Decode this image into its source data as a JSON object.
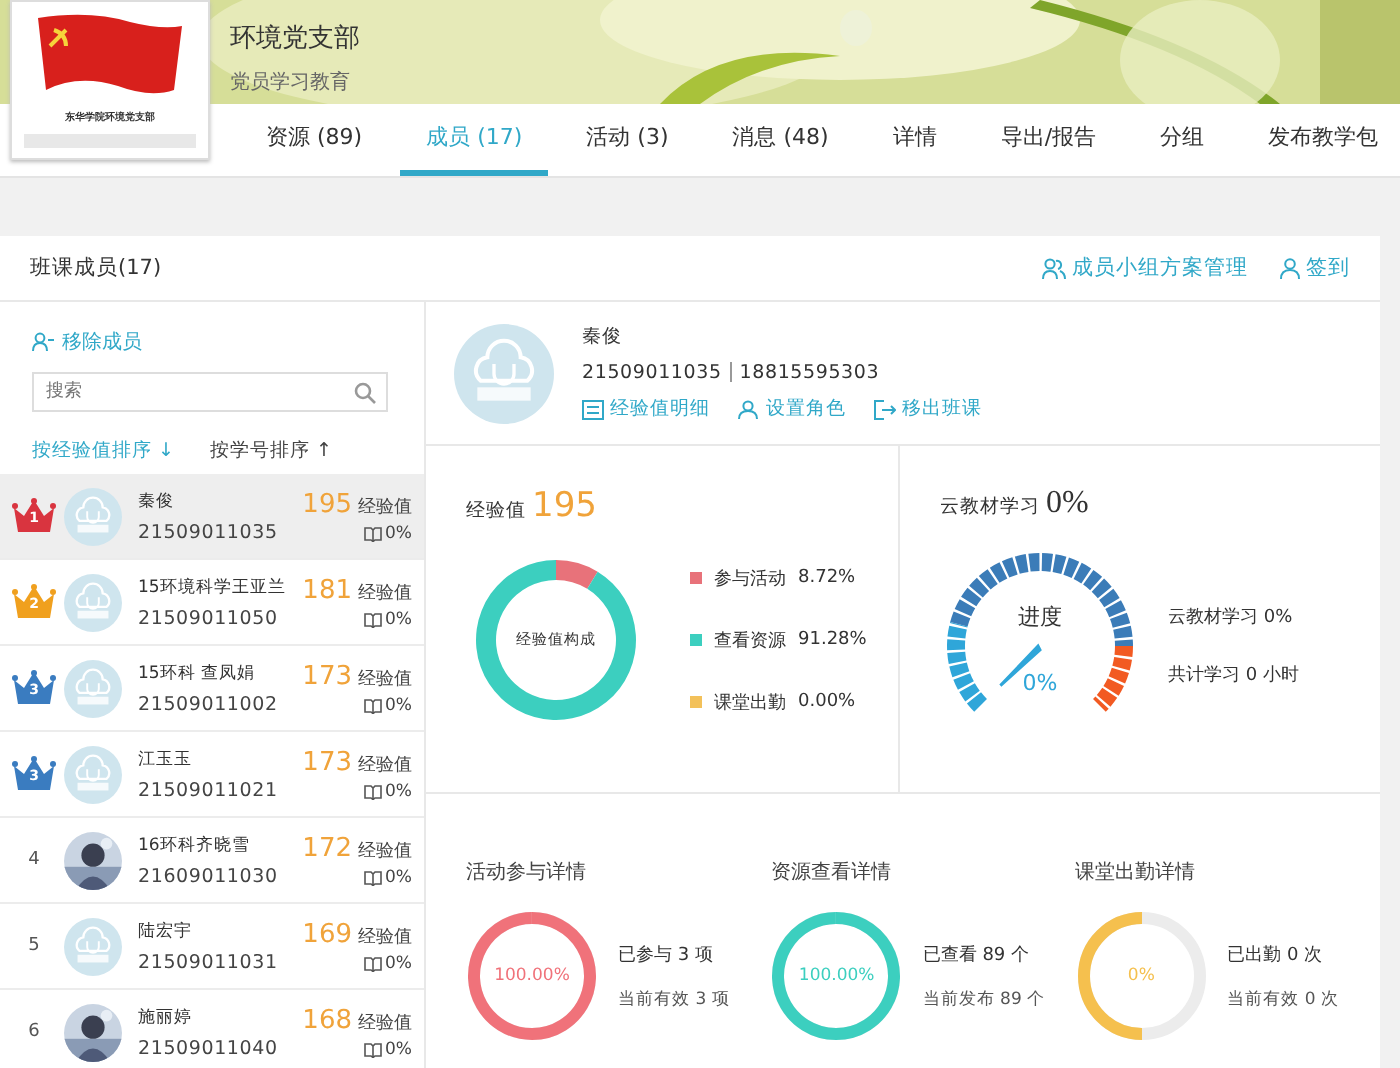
{
  "header": {
    "logo_caption": "东华学院环境党支部",
    "title": "环境党支部",
    "subtitle": "党员学习教育"
  },
  "tabs": [
    {
      "label": "资源 (89)",
      "selected": false
    },
    {
      "label": "成员 (17)",
      "selected": true
    },
    {
      "label": "活动 (3)",
      "selected": false
    },
    {
      "label": "消息 (48)",
      "selected": false
    },
    {
      "label": "详情",
      "selected": false
    },
    {
      "label": "导出/报告",
      "selected": false
    },
    {
      "label": "分组",
      "selected": false
    },
    {
      "label": "发布教学包",
      "selected": false
    }
  ],
  "panel": {
    "title": "班课成员(17)",
    "actions": [
      "成员小组方案管理",
      "签到"
    ]
  },
  "members_list": {
    "remove_label": "移除成员",
    "search": {
      "placeholder": "搜索"
    },
    "sorts": [
      {
        "label": "按经验值排序",
        "arrow": "↓",
        "selected": true
      },
      {
        "label": "按学号排序",
        "arrow": "↑",
        "selected": false
      }
    ],
    "rows": [
      {
        "badge": {
          "kind": "crown",
          "number": "1",
          "color": "#d9343f"
        },
        "avatar": {
          "kind": "default"
        },
        "name": "秦俊",
        "id": "21509011035",
        "score": "195",
        "unit": "经验值",
        "progress": "0%",
        "selected": true
      },
      {
        "badge": {
          "kind": "crown",
          "number": "2",
          "color": "#f0a01e"
        },
        "avatar": {
          "kind": "default"
        },
        "name": "15环境科学王亚兰",
        "id": "21509011050",
        "score": "181",
        "unit": "经验值",
        "progress": "0%",
        "selected": false
      },
      {
        "badge": {
          "kind": "crown",
          "number": "3",
          "color": "#3a7cc0"
        },
        "avatar": {
          "kind": "default"
        },
        "name": "15环科 查凤娟",
        "id": "21509011002",
        "score": "173",
        "unit": "经验值",
        "progress": "0%",
        "selected": false
      },
      {
        "badge": {
          "kind": "crown",
          "number": "3",
          "color": "#3a7cc0"
        },
        "avatar": {
          "kind": "default"
        },
        "name": "江玉玉",
        "id": "21509011021",
        "score": "173",
        "unit": "经验值",
        "progress": "0%",
        "selected": false
      },
      {
        "badge": {
          "kind": "plain",
          "number": "4"
        },
        "name": "16环科齐晓雪",
        "id": "21609011030",
        "score": "172",
        "unit": "经验值",
        "progress": "0%",
        "selected": false
      },
      {
        "badge": {
          "kind": "plain",
          "number": "5"
        },
        "avatar": {
          "kind": "default"
        },
        "name": "陆宏宇",
        "id": "21509011031",
        "score": "169",
        "unit": "经验值",
        "progress": "0%",
        "selected": false
      },
      {
        "badge": {
          "kind": "plain",
          "number": "6"
        },
        "name": "施丽婷",
        "id": "21509011040",
        "score": "168",
        "unit": "经验值",
        "progress": "0%",
        "selected": false
      }
    ]
  },
  "member_card": {
    "name": "秦俊",
    "id": "21509011035",
    "phone": "18815595303",
    "links": [
      "经验值明细",
      "设置角色",
      "移出班课"
    ]
  },
  "experience": {
    "label": "经验值",
    "value": "195",
    "chart_data": {
      "type": "donut",
      "title": "经验值构成",
      "categories": [
        "参与活动",
        "查看资源",
        "课堂出勤"
      ],
      "values": [
        8.72,
        91.28,
        0
      ],
      "colors": [
        "#e8727a",
        "#3ccfbf",
        "#f3c15a"
      ],
      "value_labels": [
        "8.72%",
        "91.28%",
        "0.00%"
      ]
    }
  },
  "cloud_study": {
    "label": "云教材学习",
    "value": "0%",
    "gauge": {
      "title": "进度",
      "reading": "0%"
    },
    "lines": [
      "云教材学习 0%",
      "共计学习 0 小时"
    ]
  },
  "details": [
    {
      "title": "活动参与详情",
      "color": "#f0727a",
      "level": 1,
      "percent": "100.00%",
      "lines": [
        "已参与 3 项",
        "当前有效 3 项"
      ]
    },
    {
      "title": "资源查看详情",
      "color": "#3ccfbf",
      "level": 1,
      "percent": "100.00%",
      "lines": [
        "已查看 89 个",
        "当前发布 89 个"
      ]
    },
    {
      "title": "课堂出勤详情",
      "color": "#f5c04e",
      "level": 0.5,
      "percent": "0%",
      "lines": [
        "已出勤 0 次",
        "当前有效 0 次"
      ]
    }
  ]
}
